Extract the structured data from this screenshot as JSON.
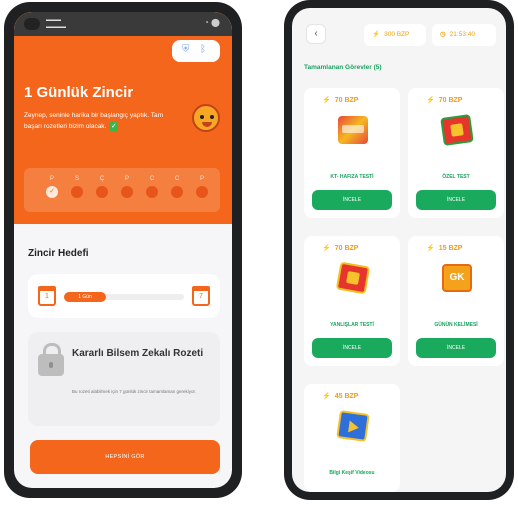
{
  "streak_screen": {
    "top_buttons": {
      "icon_a": "shield-icon",
      "icon_b": "bluetooth-icon"
    },
    "title": "1 Günlük Zincir",
    "message": "Zeynep, seninle harika bir başlangıç yaptık. Tam başarı rozetleri bizim olacak.",
    "days": [
      {
        "label": "P",
        "done": true
      },
      {
        "label": "S",
        "done": false
      },
      {
        "label": "Ç",
        "done": false
      },
      {
        "label": "P",
        "done": false
      },
      {
        "label": "C",
        "done": false
      },
      {
        "label": "C",
        "done": false
      },
      {
        "label": "P",
        "done": false
      }
    ],
    "goal": {
      "heading": "Zincir Hedefi",
      "progress_label": "1 Gün",
      "progress_fraction": 0.35
    },
    "badge": {
      "title": "Kararlı Bilsem Zekalı Rozeti",
      "description": "Bu rozeti alabilmek için 7 günlük zincir tamamlaman gerekiyor."
    },
    "cta_label": "HEPSİNİ GÖR"
  },
  "tasks_screen": {
    "back_icon": "chevron-left-icon",
    "points_badge": "300 BZP",
    "time_badge": "21:53:40",
    "section_title": "Tamamlanan Görevler (5)",
    "tasks": [
      {
        "points": "70 BZP",
        "name": "KT- HAFIZA TESTİ",
        "button": "İNCELE",
        "icon": "memory-game-icon"
      },
      {
        "points": "70 BZP",
        "name": "ÖZEL TEST",
        "button": "İNCELE",
        "icon": "gift-box-icon"
      },
      {
        "points": "70 BZP",
        "name": "YANLIŞLAR TESTİ",
        "button": "İNCELE",
        "icon": "gift-box-icon"
      },
      {
        "points": "15 BZP",
        "name": "GÜNÜN KELİMESİ",
        "button": "İNCELE",
        "icon": "word-card-icon"
      },
      {
        "points": "45 BZP",
        "name": "Bilgi Keşif Videosu",
        "icon": "play-video-icon"
      }
    ]
  }
}
